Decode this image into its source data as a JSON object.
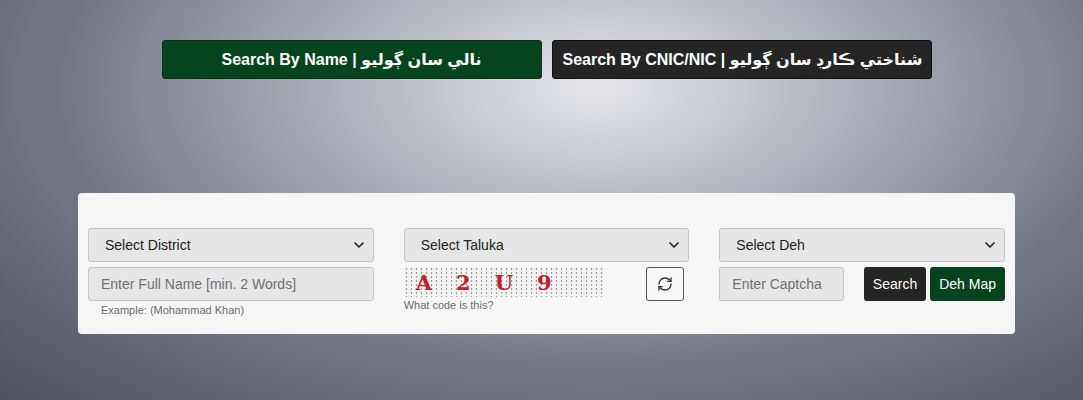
{
  "tabs": [
    {
      "label": "Search By Name | نالي سان ڳوليو",
      "selected": true,
      "color": "#064420"
    },
    {
      "label": "Search By CNIC/NIC | شناختي ڪارڊ سان ڳوليو",
      "selected": false,
      "color": "#252525"
    }
  ],
  "selects": [
    "Select District",
    "Select Taluka",
    "Select Deh"
  ],
  "name_field": {
    "placeholder": "Enter Full Name [min. 2 Words]",
    "hint": "Example: (Mohammad Khan)"
  },
  "captcha": {
    "characters": [
      "A",
      "2",
      "U",
      "9"
    ],
    "caption": "What code is this?"
  },
  "captcha_field": {
    "placeholder": "Enter Captcha"
  },
  "buttons": [
    {
      "label": "Search",
      "kind": "dark"
    },
    {
      "label": "Deh Map",
      "kind": "green"
    }
  ]
}
